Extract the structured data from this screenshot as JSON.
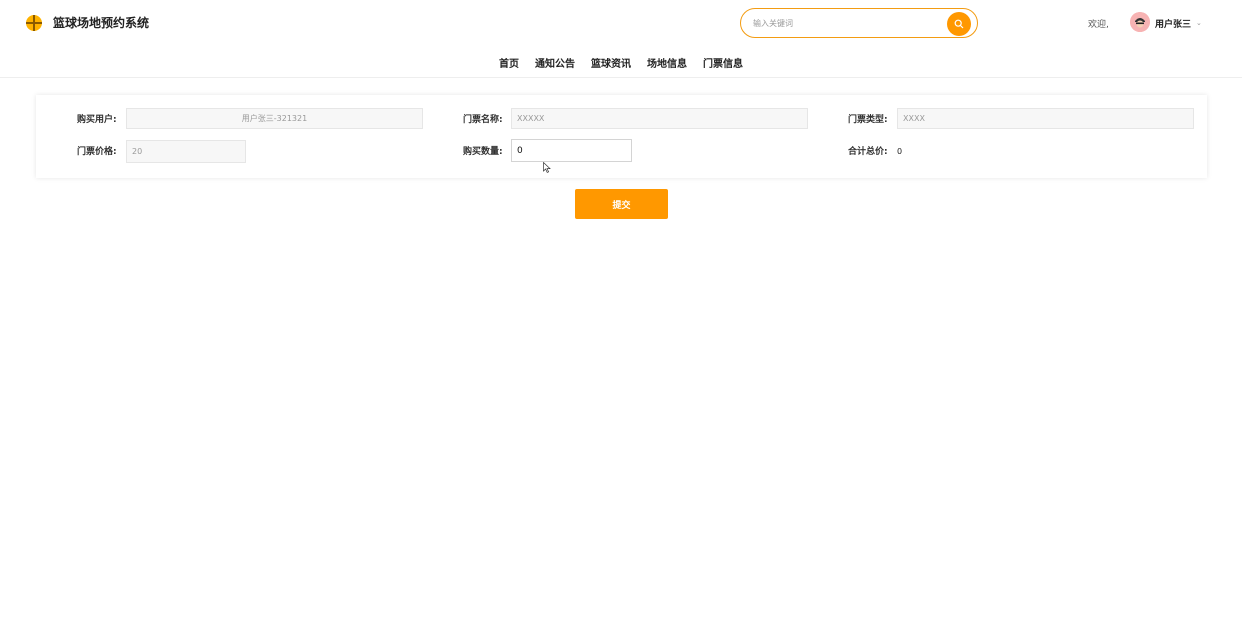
{
  "header": {
    "title": "篮球场地预约系统",
    "search": {
      "placeholder": "输入关键词",
      "value": ""
    },
    "welcome": "欢迎,",
    "username": "用户张三",
    "accent_color": "#ff9800"
  },
  "nav": [
    {
      "label": "首页"
    },
    {
      "label": "通知公告"
    },
    {
      "label": "篮球资讯"
    },
    {
      "label": "场地信息"
    },
    {
      "label": "门票信息"
    }
  ],
  "form": {
    "buyer_label": "购买用户:",
    "buyer_value": "用户张三-321321",
    "ticket_name_label": "门票名称:",
    "ticket_name_value": "XXXXX",
    "ticket_type_label": "门票类型:",
    "ticket_type_value": "XXXX",
    "price_label": "门票价格:",
    "price_value": "20",
    "quantity_label": "购买数量:",
    "quantity_value": "0",
    "total_label": "合计总价:",
    "total_value": "0"
  },
  "submit_label": "提交"
}
